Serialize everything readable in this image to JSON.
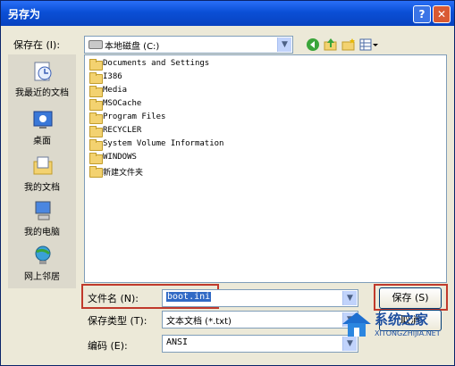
{
  "window": {
    "title": "另存为",
    "help_label": "?",
    "close_label": "✕"
  },
  "save_in": {
    "label": "保存在 (I):",
    "value": "本地磁盘 (C:)"
  },
  "places": [
    {
      "label": "我最近的文档",
      "icon": "recent-documents-icon"
    },
    {
      "label": "桌面",
      "icon": "desktop-icon"
    },
    {
      "label": "我的文档",
      "icon": "my-documents-icon"
    },
    {
      "label": "我的电脑",
      "icon": "my-computer-icon"
    },
    {
      "label": "网上邻居",
      "icon": "network-places-icon"
    }
  ],
  "files": [
    "Documents and Settings",
    "I386",
    "Media",
    "MSOCache",
    "Program Files",
    "RECYCLER",
    "System Volume Information",
    "WINDOWS",
    "新建文件夹"
  ],
  "filename": {
    "label": "文件名 (N):",
    "value": "boot.ini"
  },
  "filetype": {
    "label": "保存类型 (T):",
    "value": "文本文档 (*.txt)"
  },
  "encoding": {
    "label": "编码 (E):",
    "value": "ANSI"
  },
  "buttons": {
    "save": "保存 (S)",
    "cancel": "取消"
  },
  "watermark": {
    "text": "系统之家",
    "url": "XITONGZHIJIA.NET"
  },
  "colors": {
    "title_bar": "#0a4fd6",
    "highlight": "#c0392b",
    "dialog_bg": "#ece9d8"
  }
}
